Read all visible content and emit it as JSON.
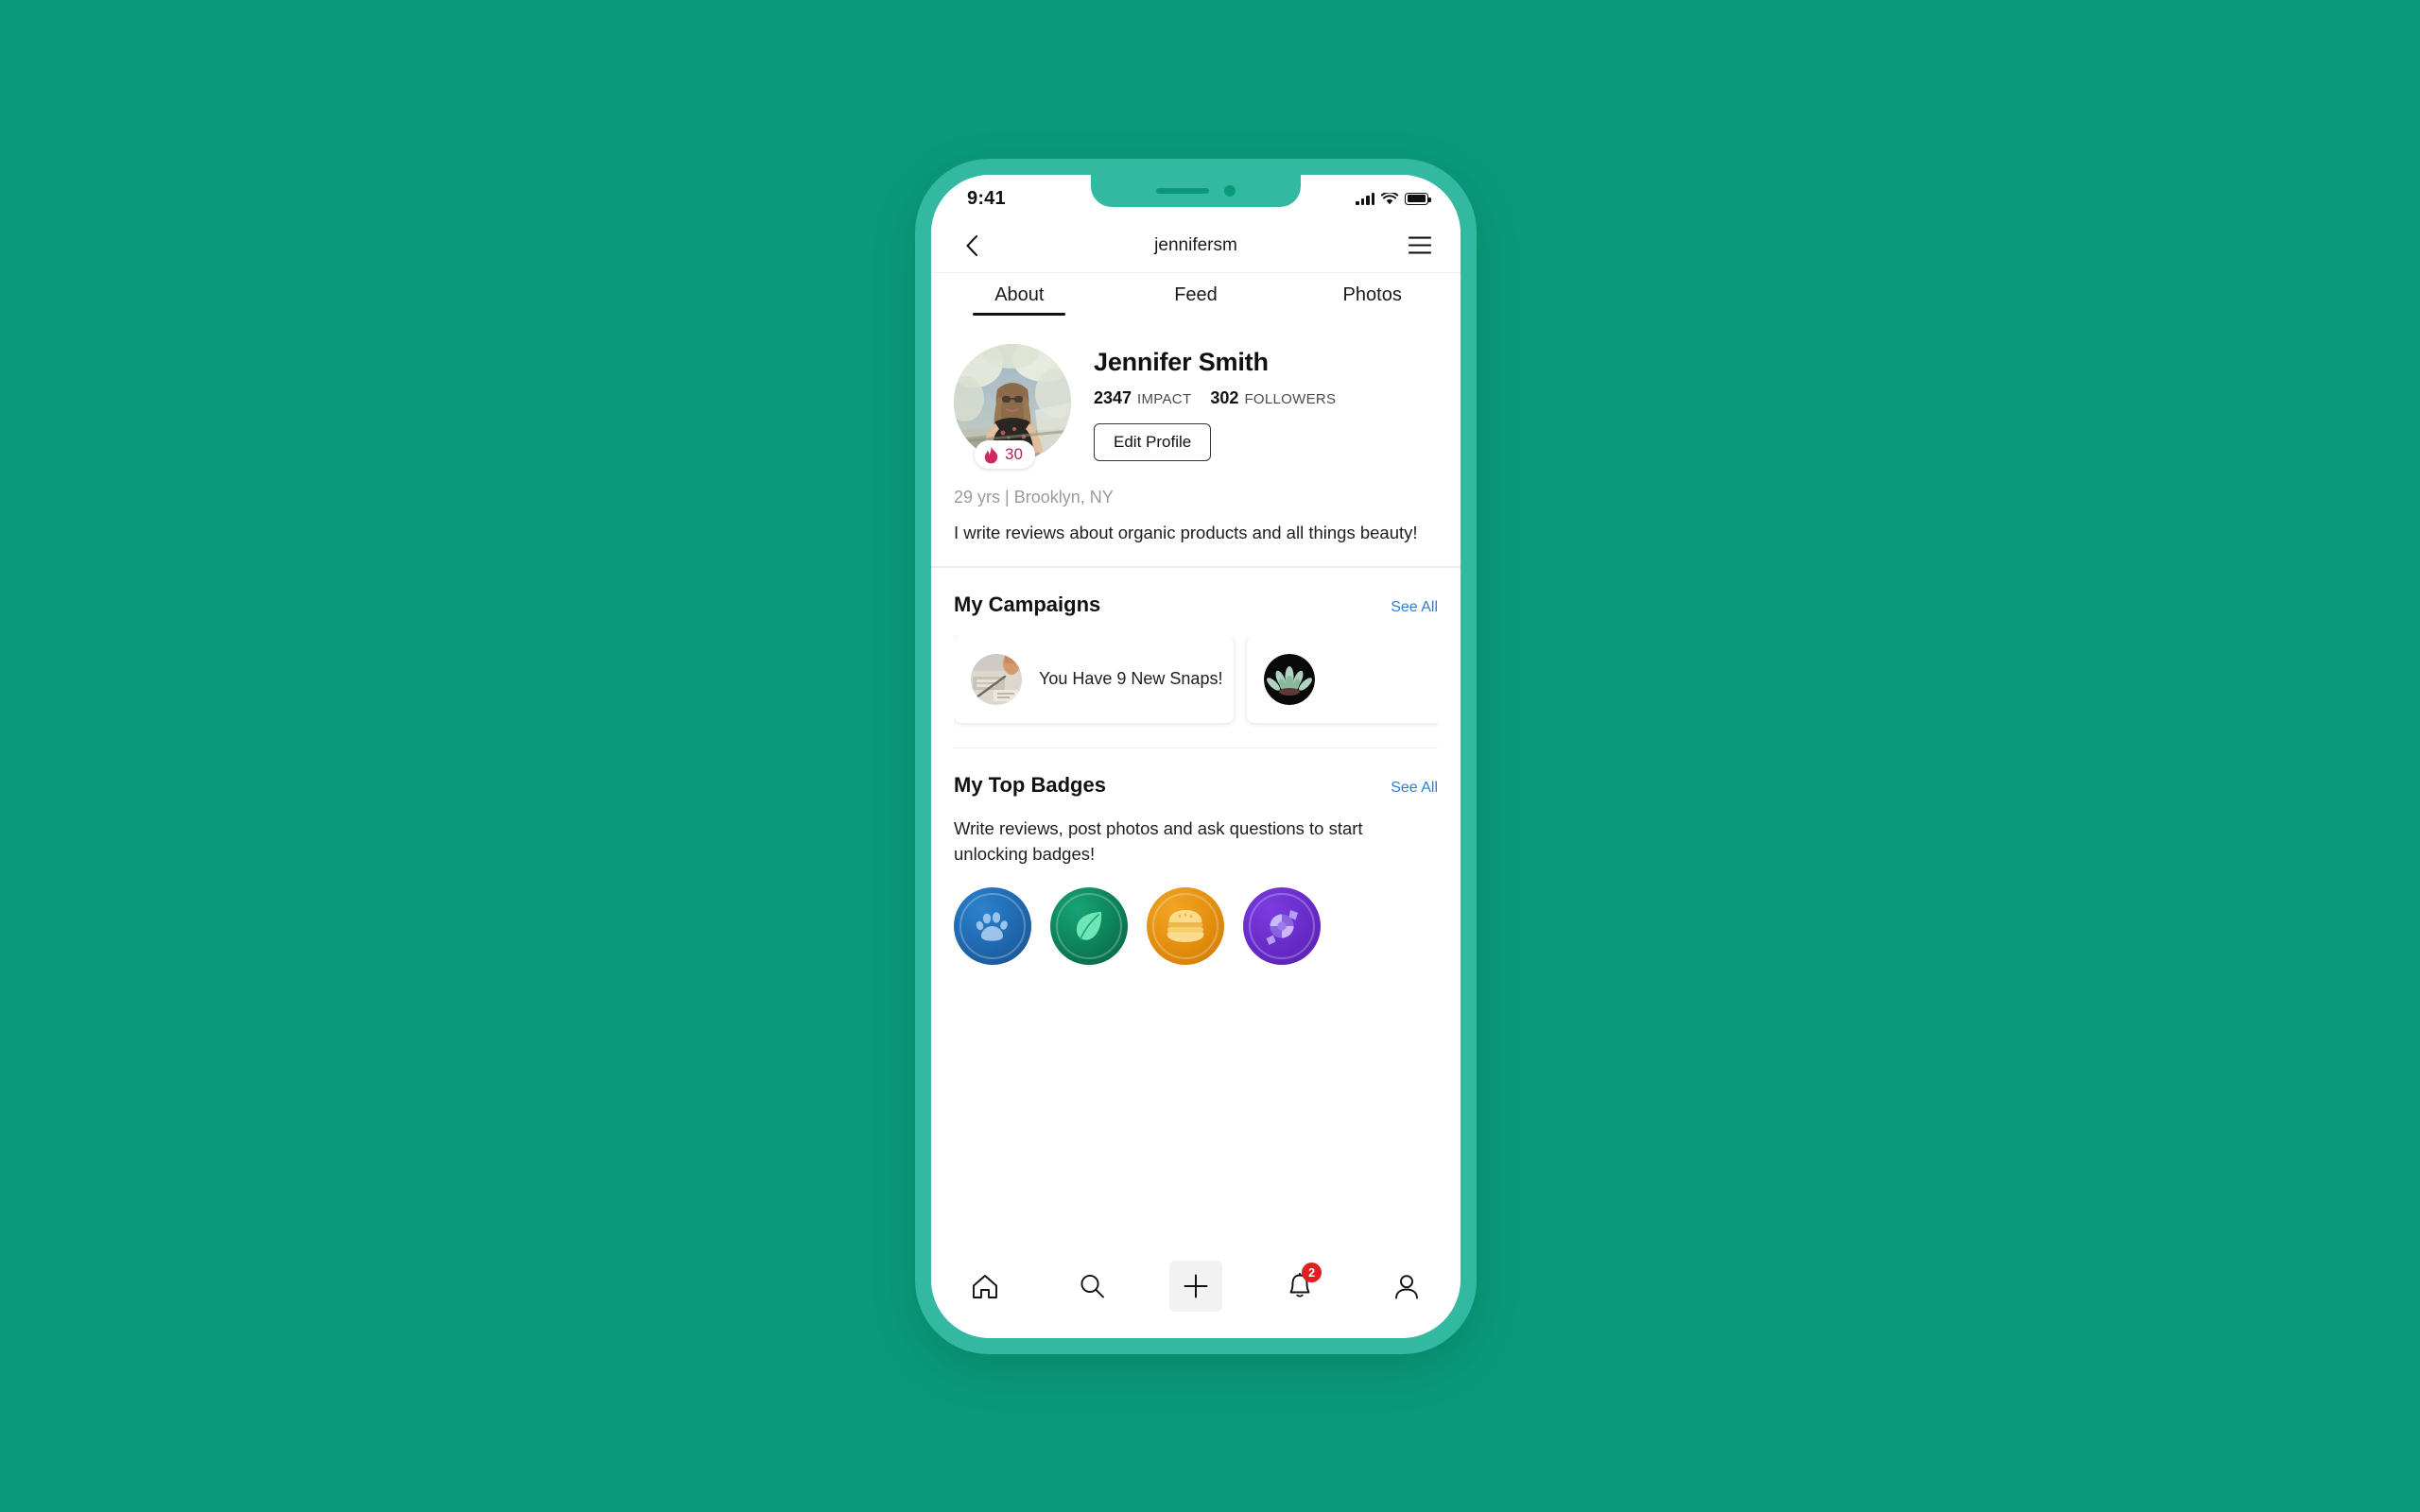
{
  "theme": {
    "page_background": "#0A9A7B",
    "phone_bezel": "#33B9A1",
    "accent_link": "#2E7CD6",
    "notification_red": "#E02020",
    "streak_crimson": "#B0284E"
  },
  "status_bar": {
    "time": "9:41",
    "signal_icon": "signal-bars-icon",
    "wifi_icon": "wifi-icon",
    "battery_icon": "battery-icon"
  },
  "nav_bar": {
    "back_icon": "chevron-left-icon",
    "title": "jennifersm",
    "menu_icon": "hamburger-menu-icon"
  },
  "tabs": {
    "active_index": 0,
    "items": [
      {
        "label": "About"
      },
      {
        "label": "Feed"
      },
      {
        "label": "Photos"
      }
    ]
  },
  "profile": {
    "avatar_alt": "profile-photo",
    "streak": {
      "icon": "flame-icon",
      "count": "30"
    },
    "name": "Jennifer Smith",
    "stats": [
      {
        "value": "2347",
        "label": "IMPACT"
      },
      {
        "value": "302",
        "label": "FOLLOWERS"
      }
    ],
    "edit_button": "Edit Profile",
    "meta": "29 yrs | Brooklyn, NY",
    "bio": "I write reviews about organic products and all things beauty!"
  },
  "campaigns": {
    "title": "My Campaigns",
    "see_all": "See All",
    "cards": [
      {
        "thumb": "desk-workspace-photo",
        "title": "You Have 9 New Snaps!"
      },
      {
        "thumb": "lotus-flower-photo",
        "title": ""
      }
    ]
  },
  "badges": {
    "title": "My Top Badges",
    "see_all": "See All",
    "description": "Write reviews, post photos and ask questions to start unlocking badges!",
    "items": [
      {
        "name": "paw-badge",
        "icon": "paw-icon",
        "color": "#1D63A8",
        "color_light": "#2B82CE",
        "glyph_color": "#9CC3EA"
      },
      {
        "name": "leaf-badge",
        "icon": "leaf-icon",
        "color": "#0B7A55",
        "color_light": "#14A070",
        "glyph_color": "#6FE6B6"
      },
      {
        "name": "burger-badge",
        "icon": "burger-icon",
        "color": "#E08A0C",
        "color_light": "#F2A524",
        "glyph_color": "#FBDC8C"
      },
      {
        "name": "candy-badge",
        "icon": "candy-icon",
        "color": "#6429C4",
        "color_light": "#7C3BE0",
        "glyph_color": "#B79CF0"
      }
    ]
  },
  "tabbar": {
    "items": [
      {
        "name": "home",
        "icon": "home-icon",
        "badge": ""
      },
      {
        "name": "search",
        "icon": "search-icon",
        "badge": ""
      },
      {
        "name": "create",
        "icon": "plus-icon",
        "badge": ""
      },
      {
        "name": "notifications",
        "icon": "bell-icon",
        "badge": "2"
      },
      {
        "name": "profile",
        "icon": "person-icon",
        "badge": ""
      }
    ]
  }
}
